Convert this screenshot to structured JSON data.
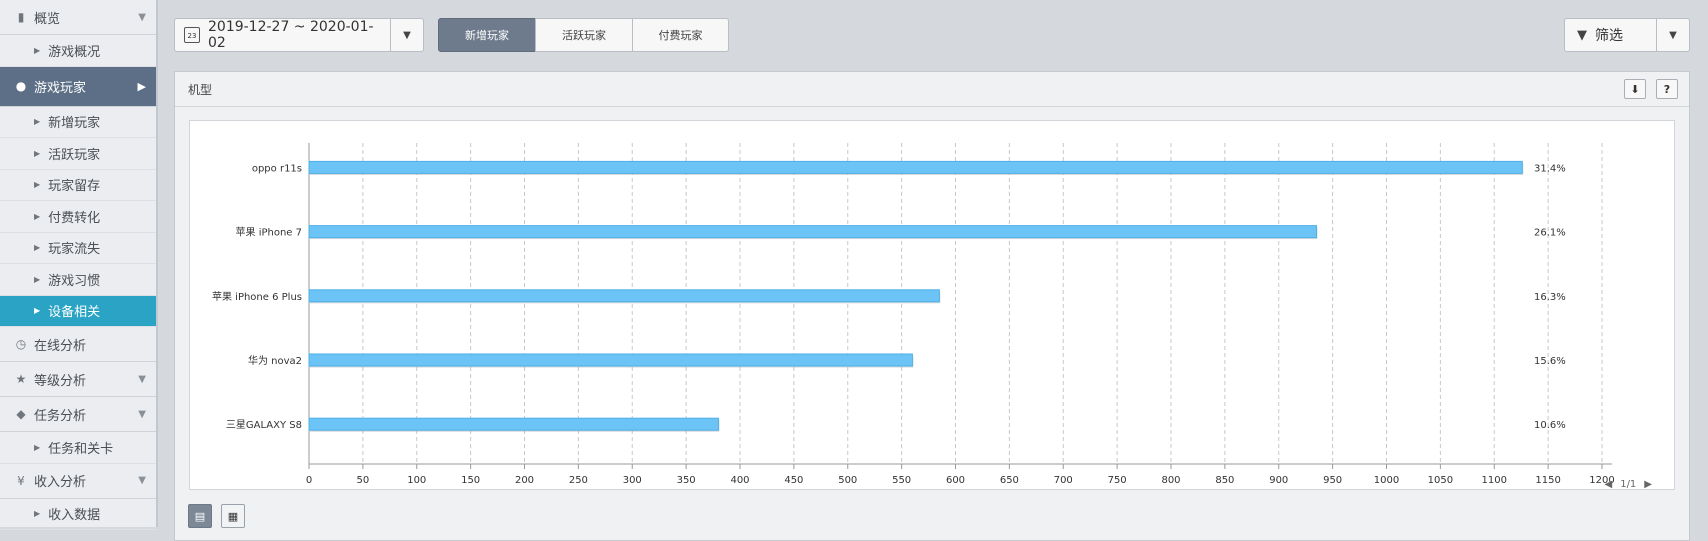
{
  "sidebar": {
    "overview": {
      "label": "概览",
      "icon": "document-icon"
    },
    "overview_items": [
      {
        "label": "游戏概况"
      }
    ],
    "players": {
      "label": "游戏玩家",
      "icon": "user-icon"
    },
    "player_items": [
      {
        "label": "新增玩家"
      },
      {
        "label": "活跃玩家"
      },
      {
        "label": "玩家留存"
      },
      {
        "label": "付费转化"
      },
      {
        "label": "玩家流失"
      },
      {
        "label": "游戏习惯"
      },
      {
        "label": "设备相关"
      }
    ],
    "online": {
      "label": "在线分析",
      "icon": "clock-icon"
    },
    "level": {
      "label": "等级分析",
      "icon": "star-icon"
    },
    "task": {
      "label": "任务分析",
      "icon": "gamepad-icon"
    },
    "task_items": [
      {
        "label": "任务和关卡"
      }
    ],
    "revenue": {
      "label": "收入分析",
      "icon": "yen-icon"
    },
    "revenue_items": [
      {
        "label": "收入数据"
      }
    ]
  },
  "toolbar": {
    "date_range": "2019-12-27 ~ 2020-01-02",
    "calendar_icon_text": "23",
    "tabs": [
      {
        "label": "新增玩家"
      },
      {
        "label": "活跃玩家"
      },
      {
        "label": "付费玩家"
      }
    ],
    "filter_label": "筛选"
  },
  "panel": {
    "title": "机型",
    "help_label": "?",
    "pager": "1/1"
  },
  "chart_data": {
    "type": "bar",
    "orientation": "horizontal",
    "categories": [
      "oppo r11s",
      "苹果 iPhone 7",
      "苹果 iPhone 6 Plus",
      "华为 nova2",
      "三星GALAXY S8"
    ],
    "values": [
      1126,
      935,
      585,
      560,
      380
    ],
    "percent_labels": [
      "31.4%",
      "26.1%",
      "16.3%",
      "15.6%",
      "10.6%"
    ],
    "xlim": [
      0,
      1200
    ],
    "xticks": [
      0,
      50,
      100,
      150,
      200,
      250,
      300,
      350,
      400,
      450,
      500,
      550,
      600,
      650,
      700,
      750,
      800,
      850,
      900,
      950,
      1000,
      1050,
      1100,
      1150,
      1200
    ],
    "grid": true,
    "bar_color": "#6cc3f5"
  }
}
